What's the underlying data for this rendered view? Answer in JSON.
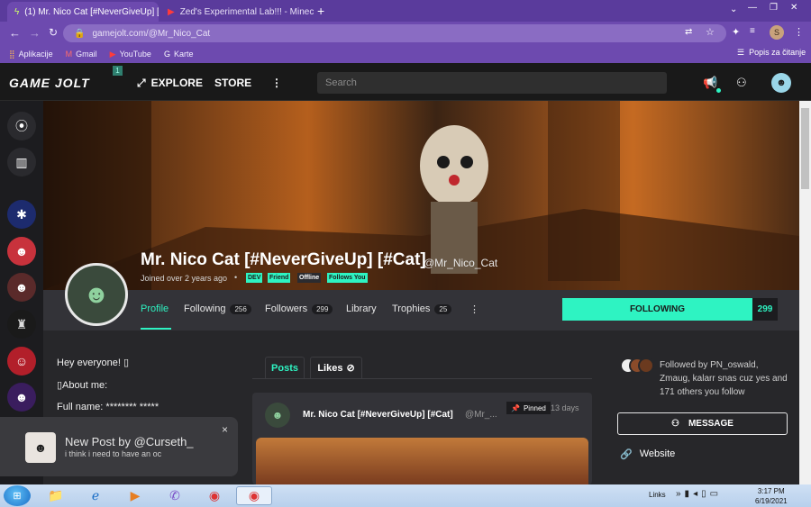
{
  "browser": {
    "tabs": [
      {
        "title": "(1) Mr. Nico Cat [#NeverGiveUp] [",
        "active": true
      },
      {
        "title": "Zed's Experimental Lab!!! - Minec",
        "active": false
      }
    ],
    "new_tab": "+",
    "url": "gamejolt.com/@Mr_Nico_Cat",
    "profile_initial": "S",
    "bookmarks": [
      "Aplikacije",
      "Gmail",
      "YouTube",
      "Karte"
    ],
    "reading_list": "Popis za čitanje",
    "window_controls": [
      "—",
      "❐",
      "✕"
    ]
  },
  "site": {
    "logo": "GAME JOLT",
    "logo_badge": "1",
    "nav": [
      "EXPLORE",
      "STORE"
    ],
    "search_placeholder": "Search"
  },
  "profile": {
    "name": "Mr. Nico Cat [#NeverGiveUp] [#Cat]",
    "handle": "@Mr_Nico_Cat",
    "joined": "Joined over 2 years ago",
    "tags": [
      "DEV",
      "Friend",
      "Offline",
      "Follows You"
    ],
    "tabs": [
      {
        "label": "Profile",
        "count": ""
      },
      {
        "label": "Following",
        "count": "256"
      },
      {
        "label": "Followers",
        "count": "299"
      },
      {
        "label": "Library",
        "count": ""
      },
      {
        "label": "Trophies",
        "count": "25"
      }
    ],
    "follow_button": "FOLLOWING",
    "follow_count": "299"
  },
  "bio": [
    "Hey everyone! ▯",
    "▯About me:",
    "Full name: ******** *****"
  ],
  "feed": {
    "tabs": [
      "Posts",
      "Likes"
    ],
    "post": {
      "author": "Mr. Nico Cat [#NeverGiveUp] [#Cat]",
      "handle": "@Mr_...",
      "pinned": "Pinned",
      "time": "13 days"
    }
  },
  "sidebar": {
    "followed_by": "Followed by PN_oswald, Zmaug, kalarr snas cuz yes and 171 others you follow",
    "message_button": "MESSAGE",
    "website": "Website"
  },
  "toast": {
    "title": "New Post by @Curseth_",
    "body": "i think i need to have an oc",
    "close": "×"
  },
  "taskbar": {
    "links": "Links",
    "time": "3:17 PM",
    "date": "6/19/2021"
  }
}
